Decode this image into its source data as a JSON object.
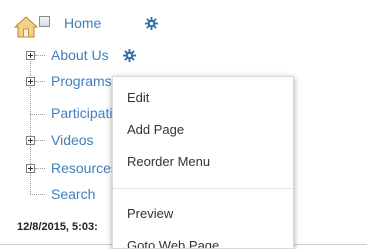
{
  "tree": {
    "root": {
      "label": "Home"
    },
    "items": [
      {
        "label": "About Us",
        "expandable": true,
        "has_gear": true
      },
      {
        "label": "Programs",
        "expandable": true,
        "has_gear": false
      },
      {
        "label": "Participati",
        "expandable": false,
        "has_gear": false
      },
      {
        "label": "Videos",
        "expandable": true,
        "has_gear": true
      },
      {
        "label": "Resources",
        "expandable": true,
        "has_gear": false
      },
      {
        "label": "Search",
        "expandable": false,
        "has_gear": true
      }
    ]
  },
  "timestamp": "12/8/2015, 5:03:",
  "context_menu": {
    "items": [
      "Edit",
      "Add Page",
      "Reorder Menu",
      "Preview",
      "Goto Web Page"
    ]
  },
  "colors": {
    "link": "#3f7fbf",
    "gear": "#2f6fb0",
    "home_icon": "#e8c06a"
  },
  "icons": {
    "home": "home-icon",
    "gear": "gear-icon",
    "expand": "plus-expander-icon"
  }
}
